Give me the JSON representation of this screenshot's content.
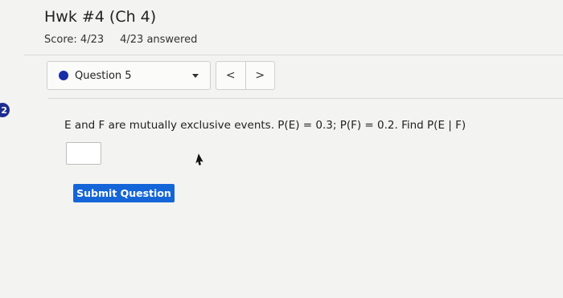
{
  "assignment": {
    "title": "Hwk #4 (Ch 4)",
    "score": "Score: 4/23",
    "answered": "4/23 answered"
  },
  "question_nav": {
    "selected_question": "Question 5",
    "prev_symbol": "<",
    "next_symbol": ">",
    "status_color": "#1a2ea6"
  },
  "side_marker": {
    "label": "2"
  },
  "question": {
    "text": "E and F are mutually exclusive events. P(E) = 0.3; P(F) = 0.2. Find P(E | F)",
    "answer_value": ""
  },
  "actions": {
    "submit_label": "Submit Question",
    "submit_color": "#1465d8"
  },
  "icons": {
    "dropdown": "chevron-down-icon",
    "prev": "chevron-left-icon",
    "next": "chevron-right-icon",
    "cursor": "mouse-pointer-icon"
  }
}
